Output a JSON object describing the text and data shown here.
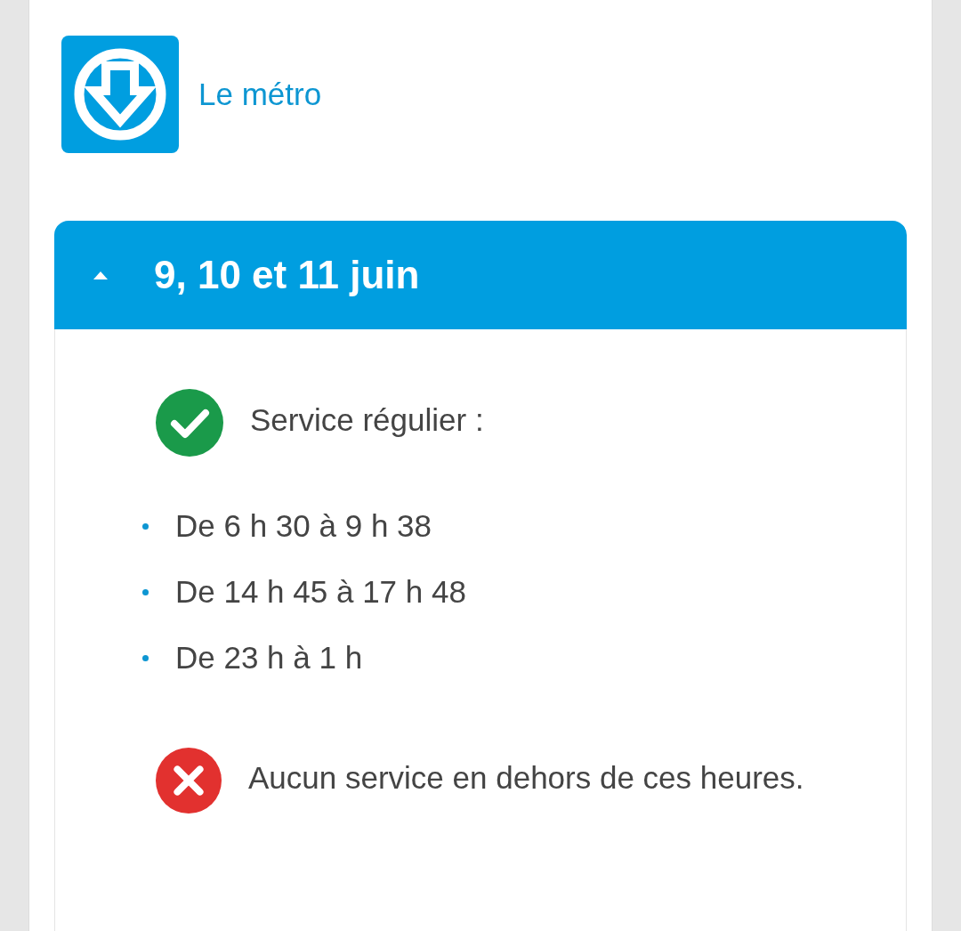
{
  "header": {
    "title": "Le métro"
  },
  "accordion": {
    "title": "9, 10 et 11 juin",
    "expanded": true,
    "blocks": [
      {
        "kind": "ok",
        "text": "Service régulier :"
      },
      {
        "kind": "list",
        "items": [
          "De 6 h 30 à 9 h 38",
          "De 14 h 45 à 17 h 48",
          "De 23 h à 1 h"
        ]
      },
      {
        "kind": "no",
        "text": "Aucun service en dehors de ces heures."
      }
    ]
  }
}
